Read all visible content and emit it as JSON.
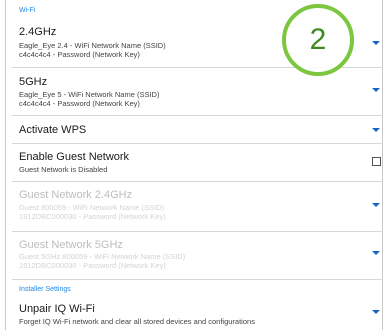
{
  "wifi_section": {
    "label": "Wi-Fi"
  },
  "rows": [
    {
      "title": "2.4GHz",
      "lines": [
        "Eagle_Eye 2.4 - WiFi Network Name (SSID)",
        "c4c4c4c4 - Password (Network Key)"
      ]
    },
    {
      "title": "5GHz",
      "lines": [
        "Eagle_Eye 5 - WiFi Network Name (SSID)",
        "c4c4c4c4 - Password (Network Key)"
      ]
    },
    {
      "title": "Activate WPS"
    },
    {
      "title": "Enable Guest Network",
      "lines": [
        "Guest Network is Disabled"
      ]
    },
    {
      "title": "Guest Network 2.4GHz",
      "lines": [
        "Guest 800059 - WiFi Network Name (SSID)",
        "1912DBC000030 - Password (Network Key)"
      ]
    },
    {
      "title": "Guest Network 5GHz",
      "lines": [
        "Guest 5GHz 800059 - WiFi Network Name (SSID)",
        "1912DBC000030 - Password (Network Key)"
      ]
    }
  ],
  "installer_section": {
    "label": "Installer Settings"
  },
  "unpair": {
    "title": "Unpair IQ Wi-Fi",
    "lines": [
      "Forget IQ Wi-Fi network and clear all stored devices and configurations"
    ]
  },
  "step_badge": {
    "number": "2",
    "color": "#7cc73f"
  },
  "colors": {
    "accent": "#1e88e5",
    "caret": "#1565c0",
    "disabled_text": "#bdbdbd"
  }
}
